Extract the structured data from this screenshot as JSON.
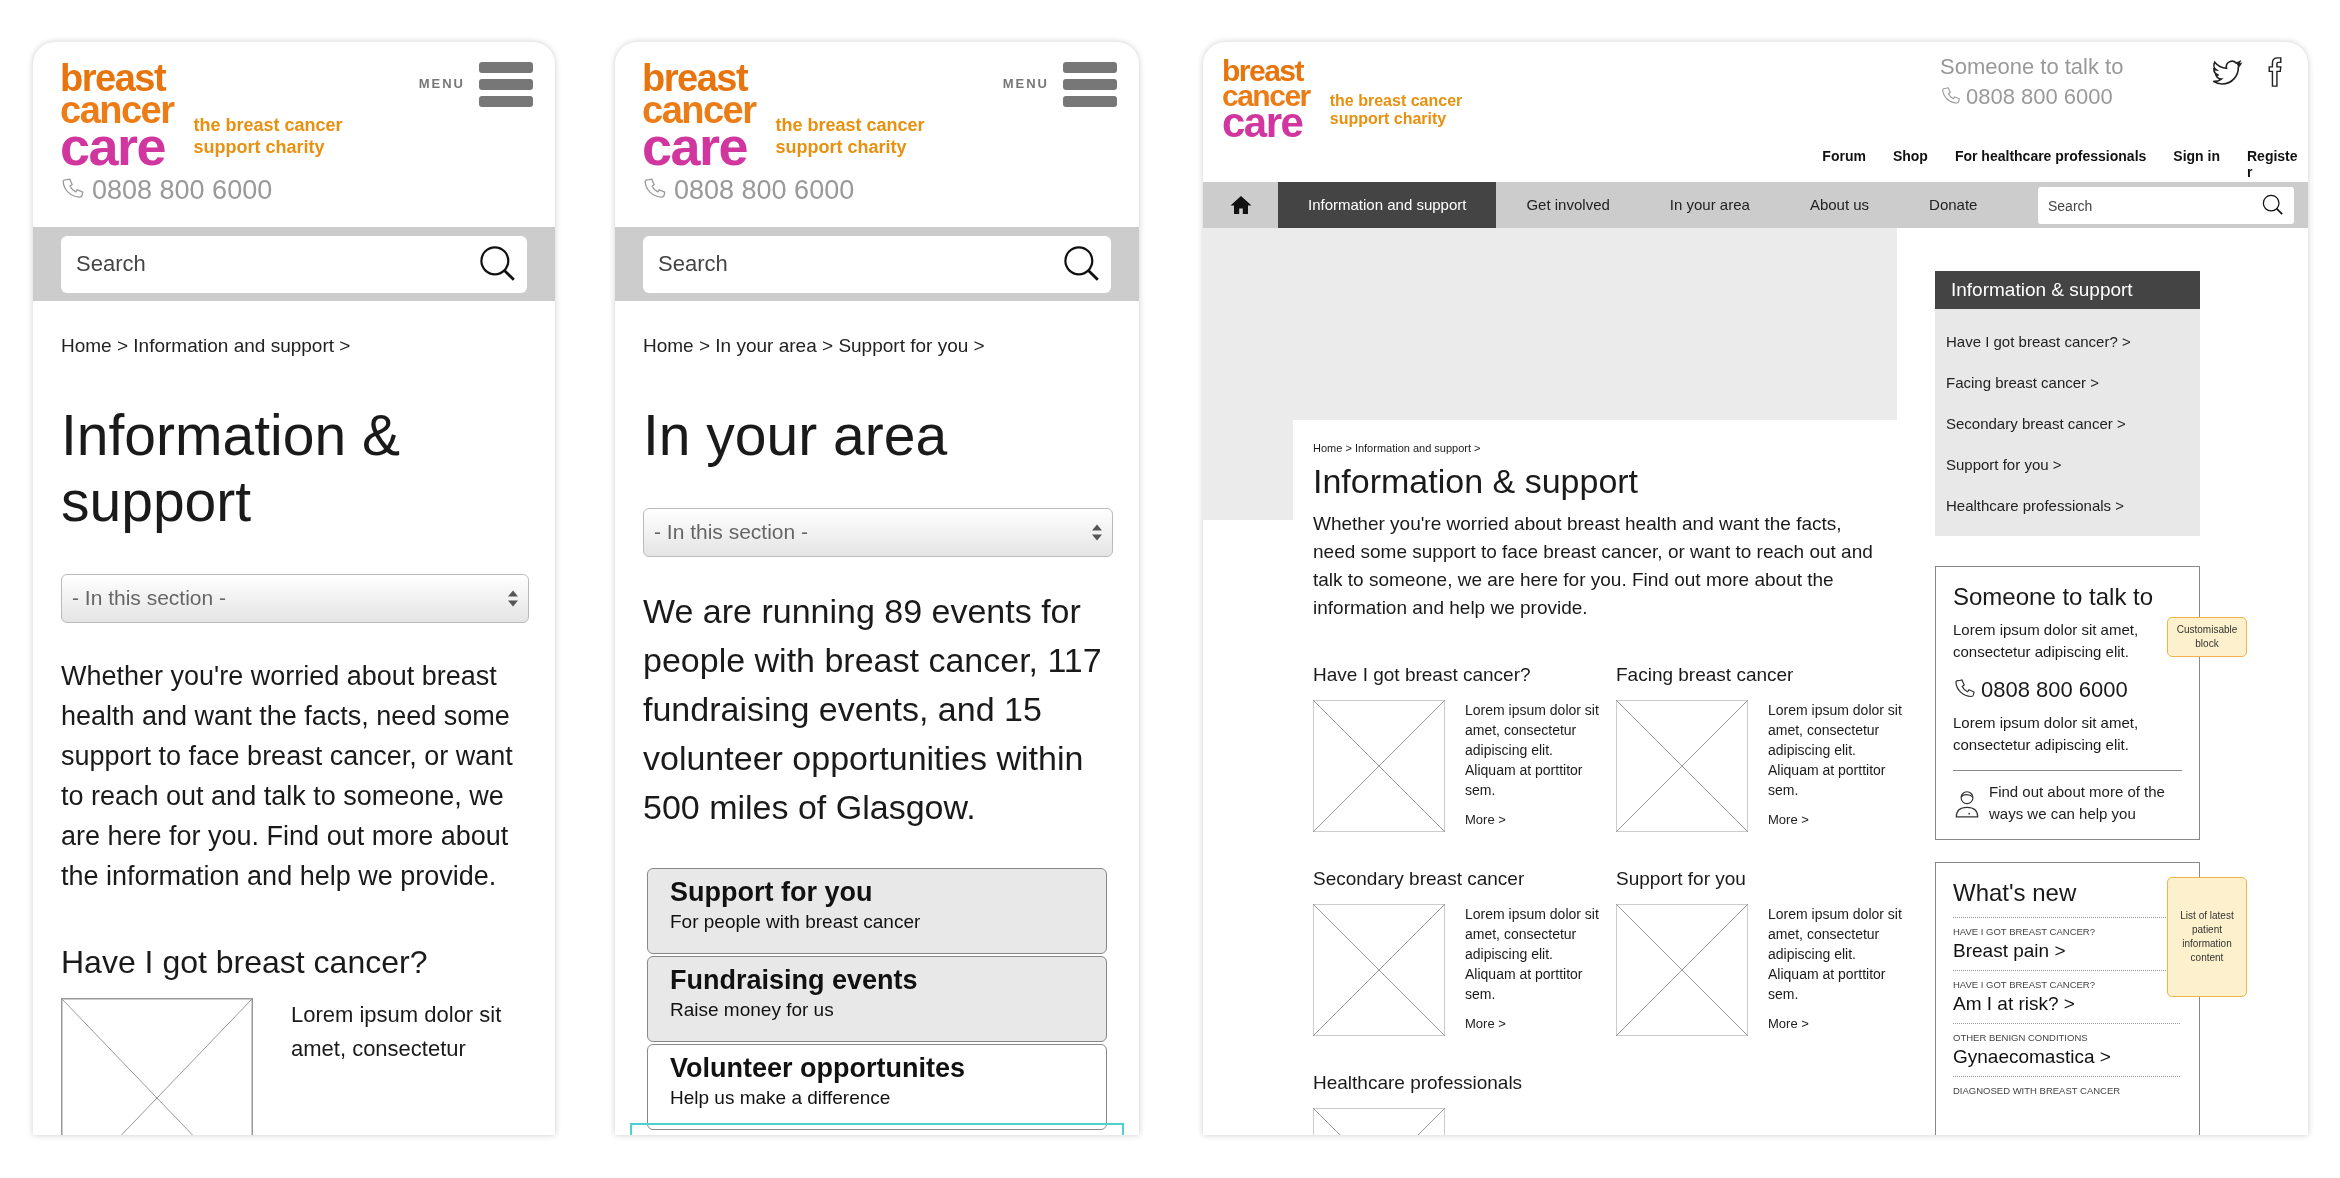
{
  "mobile_information_page": {
    "logo": [
      "breast",
      "cancer",
      "care"
    ],
    "tagline": [
      "the breast cancer",
      "support charity"
    ],
    "menu_label": "MENU",
    "phone": "0808 800 6000",
    "search": {
      "placeholder": "Search"
    },
    "breadcrumb": "Home > Information and support >",
    "title": "Information & support",
    "section_select": "- In this section -",
    "intro": "Whether you're worried about breast health and want the facts, need some support to face breast cancer, or want to reach out and talk to someone, we are here for you. Find out more about the information and help we provide.",
    "sections": [
      {
        "heading": "Have I got breast cancer?",
        "text": "Lorem ipsum dolor sit amet, consectetur"
      }
    ]
  },
  "mobile_area_page": {
    "logo": [
      "breast",
      "cancer",
      "care"
    ],
    "tagline": [
      "the breast cancer",
      "support charity"
    ],
    "menu_label": "MENU",
    "phone": "0808 800 6000",
    "search": {
      "placeholder": "Search"
    },
    "breadcrumb": "Home > In your area > Support for you >",
    "title": "In your area",
    "section_select": "- In this section -",
    "intro": "We are running 89 events for people with breast cancer, 117 fundraising events, and 15 volunteer opportunities within 500 miles of Glasgow.",
    "links": [
      {
        "title": "Support for you",
        "subtitle": "For people with breast cancer",
        "shaded": true
      },
      {
        "title": "Fundraising events",
        "subtitle": "Raise money for us",
        "shaded": true
      },
      {
        "title": "Volunteer opportunites",
        "subtitle": "Help us make a difference",
        "shaded": false
      }
    ]
  },
  "desktop_page": {
    "logo": [
      "breast",
      "cancer",
      "care"
    ],
    "tagline": [
      "the breast cancer",
      "support charity"
    ],
    "contact_heading": "Someone to talk to",
    "phone": "0808 800 6000",
    "utility_links": [
      "Forum",
      "Shop",
      "For healthcare professionals",
      "Sign in",
      "Register"
    ],
    "nav": [
      {
        "label": "Information and support",
        "selected": true
      },
      {
        "label": "Get involved",
        "selected": false
      },
      {
        "label": "In your area",
        "selected": false
      },
      {
        "label": "About us",
        "selected": false
      },
      {
        "label": "Donate",
        "selected": false
      }
    ],
    "search": {
      "placeholder": "Search"
    },
    "breadcrumb": "Home > Information and support  >",
    "title": "Information & support",
    "intro": "Whether you're worried about breast health and want the facts, need some support to face breast cancer, or want to reach out and talk to someone, we are here for you. Find out more about the information and help we provide.",
    "topics": [
      {
        "heading": "Have I got breast cancer?",
        "text": "Lorem ipsum dolor sit amet, consectetur adipiscing elit. Aliquam at porttitor sem.",
        "more": "More >"
      },
      {
        "heading": "Facing breast cancer",
        "text": "Lorem ipsum dolor sit amet, consectetur adipiscing elit. Aliquam at porttitor sem.",
        "more": "More >"
      },
      {
        "heading": "Secondary breast cancer",
        "text": "Lorem ipsum dolor sit amet, consectetur adipiscing elit. Aliquam at porttitor sem.",
        "more": "More >"
      },
      {
        "heading": "Support for you",
        "text": "Lorem ipsum dolor sit amet, consectetur adipiscing elit. Aliquam at porttitor sem.",
        "more": "More >"
      },
      {
        "heading": "Healthcare professionals"
      }
    ],
    "sidebar": {
      "heading": "Information & support",
      "items": [
        "Have I got breast cancer? >",
        "Facing breast cancer >",
        "Secondary breast cancer >",
        "Support for you >",
        "Healthcare professionals >"
      ]
    },
    "talk_box": {
      "title": "Someone to talk to",
      "text_1": "Lorem ipsum dolor sit amet, consectetur adipiscing elit.",
      "phone": "0808 800 6000",
      "text_2": "Lorem ipsum dolor sit amet, consectetur adipiscing elit.",
      "help_link": "Find out about more of the ways we can help you",
      "note": "Customisable block"
    },
    "whats_new": {
      "title": "What's new",
      "note": "List of latest patient information content",
      "items": [
        {
          "category": "HAVE I GOT BREAST CANCER?",
          "link": "Breast pain >"
        },
        {
          "category": "HAVE I GOT BREAST CANCER?",
          "link": "Am I at risk? >"
        },
        {
          "category": "OTHER BENIGN CONDITIONS",
          "link": "Gynaecomastica >"
        },
        {
          "category": "DIAGNOSED WITH BREAST CANCER"
        }
      ]
    }
  }
}
